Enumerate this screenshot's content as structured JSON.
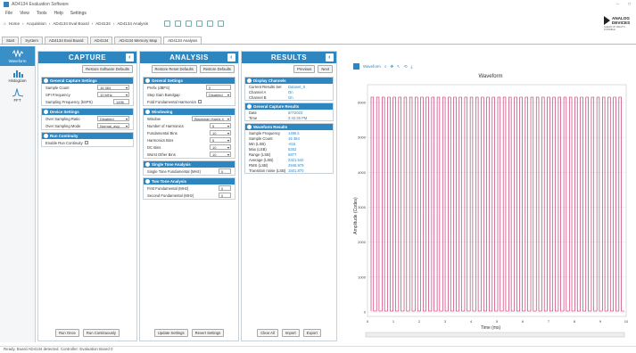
{
  "window": {
    "title": "AD4134 Evaluation Software"
  },
  "menu": [
    "File",
    "View",
    "Tools",
    "Help",
    "Settings"
  ],
  "crumbs": [
    "Home",
    "Acquisition",
    "AD4134 Eval Board",
    "AD4134",
    "AD4134 Analysis"
  ],
  "tabs": [
    "Start",
    "System",
    "AD4134 Eval Board",
    "AD4134",
    "AD4134 Memory Map",
    "AD4134 Analysis"
  ],
  "logo": {
    "line1": "ANALOG",
    "line2": "DEVICES",
    "tag": "AHEAD OF WHAT'S POSSIBLE"
  },
  "nav": [
    {
      "label": "Waveform",
      "active": true
    },
    {
      "label": "Histogram",
      "active": false
    },
    {
      "label": "FFT",
      "active": false
    }
  ],
  "capture": {
    "title": "CAPTURE",
    "reset_btn": "Restore Software Defaults",
    "general": {
      "title": "General Capture Settings",
      "rows": [
        {
          "label": "Sample Count",
          "value": "16 384"
        },
        {
          "label": "SPI Frequency",
          "value": "10 MHz"
        },
        {
          "label": "Sampling Frequency (kSPS)",
          "value": "1496"
        }
      ]
    },
    "device": {
      "title": "Device Settings",
      "rows": [
        {
          "label": "Over Sampling Ratio",
          "value": "Disabled"
        },
        {
          "label": "Over Sampling Mode",
          "value": "Normal_avg"
        }
      ]
    },
    "continuity": {
      "title": "Run Continuity",
      "label": "Enable Run Continuity"
    },
    "btn_run": "Run Once",
    "btn_cont": "Run Continuously"
  },
  "analysis": {
    "title": "ANALYSIS",
    "btn_restore": "Restore Reset Defaults",
    "btn_restore2": "Restore Defaults",
    "general": {
      "title": "General Settings",
      "rows": [
        {
          "label": "Prefix (dBFS)",
          "value": "0"
        },
        {
          "label": "Step Gain Bandgap",
          "value": "Disabled"
        },
        {
          "label": "Fold Fundamental Harmonics",
          "value": ""
        }
      ]
    },
    "windowing": {
      "title": "Windowing",
      "rows": [
        {
          "label": "Window",
          "value": "Blackman Harris 4"
        },
        {
          "label": "Number of Harmonics",
          "value": "5"
        },
        {
          "label": "Fundamental Bins",
          "value": "10"
        },
        {
          "label": "Harmonics Bins",
          "value": "5"
        },
        {
          "label": "DC Bins",
          "value": "10"
        },
        {
          "label": "Worst Other Bins",
          "value": "10"
        }
      ]
    },
    "single": {
      "title": "Single Tone Analysis",
      "label": "Single Tone Fundamental (MHz)",
      "value": "0"
    },
    "two": {
      "title": "Two Tone Analysis",
      "rows": [
        {
          "label": "First Fundamental (MHz)",
          "value": "0"
        },
        {
          "label": "Second Fundamental (MHz)",
          "value": "0"
        }
      ]
    },
    "btn_apply": "Update Settings",
    "btn_revert": "Revert Settings"
  },
  "results": {
    "title": "RESULTS",
    "btn_prev": "Previous",
    "btn_next": "Next",
    "display": {
      "title": "Display Channels",
      "rows": [
        {
          "k": "Current Results Set",
          "v": "Dataset_0"
        },
        {
          "k": "Channel A",
          "v": "On"
        },
        {
          "k": "Channel B",
          "v": "On"
        }
      ]
    },
    "general": {
      "title": "General Capture Results",
      "rows": [
        {
          "k": "Date",
          "v": "6/7/2023"
        },
        {
          "k": "Time",
          "v": "3:42:25 PM"
        }
      ]
    },
    "waveform": {
      "title": "Waveform Results",
      "rows": [
        {
          "k": "Sample Frequency",
          "v": "1496 k"
        },
        {
          "k": "Sample Count",
          "v": "16 384"
        },
        {
          "k": "Min (LSB)",
          "v": "-615"
        },
        {
          "k": "Max (LSB)",
          "v": "5262"
        },
        {
          "k": "Range (LSB)",
          "v": "5877"
        },
        {
          "k": "Average (LSB)",
          "v": "2321.542"
        },
        {
          "k": "RMS (LSB)",
          "v": "2946.979"
        },
        {
          "k": "Transition noise (LSB)",
          "v": "1501.870"
        }
      ]
    },
    "btn_clear": "Clear All",
    "btn_import": "Import",
    "btn_export": "Export"
  },
  "plot": {
    "title": "Waveform",
    "toolbar": [
      "Waveform",
      "Zoom",
      "Pan",
      "Cursor",
      "Reset",
      "Export"
    ],
    "xlabel": "Time (ms)",
    "ylabel": "Amplitude (Codes)",
    "yticks": [
      "6000",
      "5000",
      "4000",
      "3000",
      "2000",
      "1000",
      "0"
    ],
    "xticks": [
      "0",
      "1",
      "2",
      "3",
      "4",
      "5",
      "6",
      "7",
      "8",
      "9",
      "10"
    ]
  },
  "colors": {
    "accent": "#2e86c1",
    "trace": "#c2185b"
  },
  "status": "Ready. Board AD4134 detected. Controller: Evaluation Board 0"
}
